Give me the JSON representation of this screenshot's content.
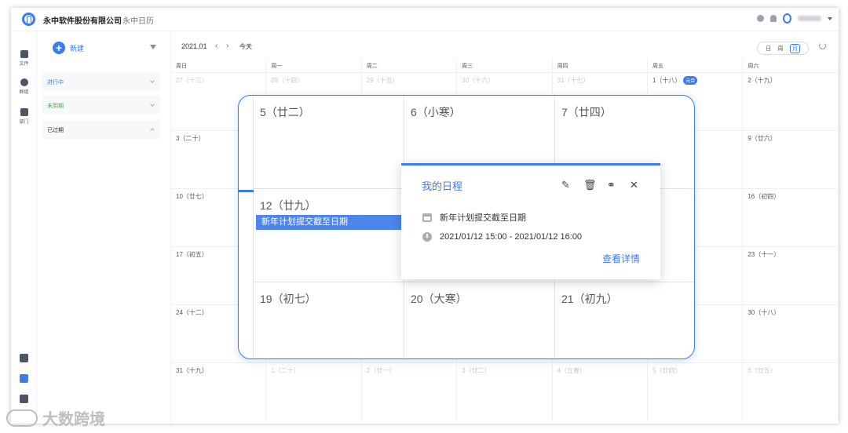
{
  "header": {
    "company": "永中软件股份有限公司",
    "app": "永中日历"
  },
  "rail": {
    "items": [
      {
        "label": "文件"
      },
      {
        "label": "群组"
      },
      {
        "label": "部门"
      }
    ]
  },
  "panel": {
    "new_label": "新建",
    "groups": [
      {
        "label": "进行中",
        "color": "#3b7df0"
      },
      {
        "label": "未到期",
        "color": "#3bb24a"
      },
      {
        "label": "已过期",
        "color": "#333333"
      }
    ]
  },
  "calendar": {
    "month": "2021.01",
    "prev": "‹",
    "next": "›",
    "today": "今天",
    "views": [
      "日",
      "周",
      "月"
    ],
    "active_view": "月",
    "weekdays": [
      "周日",
      "周一",
      "周二",
      "周三",
      "周四",
      "周五",
      "周六"
    ],
    "weeks": [
      [
        "27（十三）",
        "28（十四）",
        "29（十五）",
        "30（十六）",
        "31（十七）",
        "1（十八）",
        "2（十九）"
      ],
      [
        "3（二十）",
        "",
        "",
        "",
        "",
        "",
        "9（廿六）"
      ],
      [
        "10（廿七）",
        "",
        "",
        "",
        "",
        "",
        "16（初四）"
      ],
      [
        "17（初五）",
        "",
        "",
        "",
        "",
        "",
        "23（十一）"
      ],
      [
        "24（十二）",
        "",
        "",
        "",
        "",
        "",
        "30（十八）"
      ],
      [
        "31（十九）",
        "1（二十）",
        "2（廿一）",
        "3（廿二）",
        "4（立春）",
        "5（廿四）",
        "6（廿五）"
      ]
    ],
    "newyear_badge": "元旦"
  },
  "zoom": {
    "days": [
      "5（廿二）",
      "6（小寒）",
      "7（廿四）",
      "12（廿九）",
      "19（初七）",
      "20（大寒）",
      "21（初九）"
    ],
    "event": "新年计划提交截至日期"
  },
  "popup": {
    "title": "我的日程",
    "event": "新年计划提交截至日期",
    "time": "2021/01/12 15:00 - 2021/01/12 16:00",
    "link": "查看详情",
    "edit": "✎",
    "delete": "🗑",
    "share": "⚭",
    "close": "✕"
  },
  "watermark": "大数跨境"
}
